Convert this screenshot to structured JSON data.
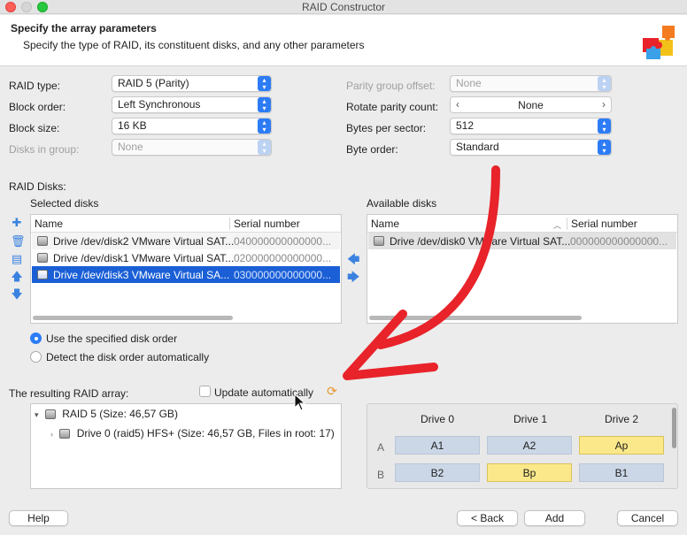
{
  "window": {
    "title": "RAID Constructor"
  },
  "header": {
    "title": "Specify the array parameters",
    "subtitle": "Specify the type of RAID, its constituent disks, and any other parameters",
    "icon": "puzzle-icon"
  },
  "params": {
    "raid_type": {
      "label": "RAID type:",
      "value": "RAID 5 (Parity)"
    },
    "block_order": {
      "label": "Block order:",
      "value": "Left Synchronous"
    },
    "block_size": {
      "label": "Block size:",
      "value": "16 KB"
    },
    "disks_in_group": {
      "label": "Disks in group:",
      "value": "None"
    },
    "parity_group_offset": {
      "label": "Parity group offset:",
      "value": "None"
    },
    "rotate_parity_count": {
      "label": "Rotate parity count:",
      "value": "None"
    },
    "bytes_per_sector": {
      "label": "Bytes per sector:",
      "value": "512"
    },
    "byte_order": {
      "label": "Byte order:",
      "value": "Standard"
    }
  },
  "raid_disks": {
    "label": "RAID Disks:",
    "selected": {
      "label": "Selected disks",
      "columns": [
        "Name",
        "Serial number"
      ],
      "rows": [
        {
          "name": "Drive /dev/disk2 VMware Virtual SAT...",
          "serial": "040000000000000..."
        },
        {
          "name": "Drive /dev/disk1 VMware Virtual SAT...",
          "serial": "020000000000000..."
        },
        {
          "name": "Drive /dev/disk3 VMware Virtual SA...",
          "serial": "030000000000000..."
        }
      ]
    },
    "available": {
      "label": "Available disks",
      "columns": [
        "Name",
        "Serial number"
      ],
      "rows": [
        {
          "name": "Drive /dev/disk0 VMware Virtual SAT...",
          "serial": "000000000000000..."
        }
      ]
    }
  },
  "disk_order": {
    "specified": "Use the specified disk order",
    "automatic": "Detect the disk order automatically"
  },
  "result": {
    "label": "The resulting RAID array:",
    "update_auto": "Update automatically",
    "tree": {
      "root": "RAID 5 (Size: 46,57 GB)",
      "child": "Drive 0 (raid5) HFS+ (Size: 46,57 GB, Files in root: 17)"
    }
  },
  "layout_grid": {
    "drives": [
      "Drive 0",
      "Drive 1",
      "Drive 2"
    ],
    "rows": [
      {
        "label": "A",
        "cells": [
          "A1",
          "A2",
          "Ap"
        ]
      },
      {
        "label": "B",
        "cells": [
          "B2",
          "Bp",
          "B1"
        ]
      }
    ]
  },
  "buttons": {
    "help": "Help",
    "back": "< Back",
    "add": "Add",
    "cancel": "Cancel"
  },
  "colors": {
    "accent": "#2d7cf6",
    "selection": "#1a5fd6",
    "data_cell": "#cbd7e6",
    "parity_cell": "#fbe88a",
    "annotation": "#e8232a"
  }
}
